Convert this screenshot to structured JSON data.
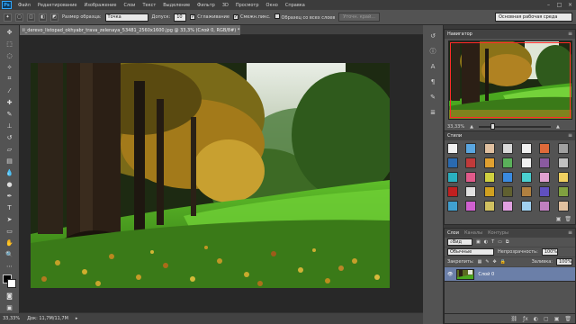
{
  "app": {
    "logo_text": "Ps"
  },
  "menu": [
    "Файл",
    "Редактирование",
    "Изображение",
    "Слои",
    "Текст",
    "Выделение",
    "Фильтр",
    "3D",
    "Просмотр",
    "Окно",
    "Справка"
  ],
  "window_controls": {
    "minimize": "–",
    "maximize": "□",
    "close": "×"
  },
  "options_bar": {
    "sample_size_label": "Размер образца:",
    "sample_size_value": "Точка",
    "tolerance_label": "Допуск:",
    "tolerance_value": "10",
    "anti_alias_label": "Сглаживание",
    "contiguous_label": "Смежн.пикс.",
    "all_layers_label": "Образец со всех слоев",
    "refine_edge_button": "Уточн. край...",
    "workspace_value": "Основная рабочая среда"
  },
  "document": {
    "tab_title": "ii_derevo_listopad_okhyabr_trava_zelenaya_53481_2560x1600.jpg @ 33,3% (Слой 0, RGB/8#) *",
    "tab_close": "×",
    "zoom": "33,33%",
    "doc_info": "Док: 11,7M/11,7M",
    "status_arrow": "▸"
  },
  "navigator": {
    "title": "Навигатор",
    "zoom": "33,33%",
    "zoom_level": 0.18
  },
  "swatches": {
    "title": "Стили",
    "colors": [
      "#f0f0f0",
      "#5aa6e0",
      "#e0c0a0",
      "#d8d8d8",
      "#f0f0f0",
      "#e06a3a",
      "#a0a0a0",
      "#2a6ab0",
      "#c03a3a",
      "#e0a030",
      "#5ab05a",
      "#f0f0f0",
      "#8a5aa0",
      "#c0c0c0",
      "#2ab0c0",
      "#e05a8a",
      "#d0d040",
      "#3a8ae0",
      "#4ad0d0",
      "#e0a0d0",
      "#f0d060",
      "#c02020",
      "#e0e0e0",
      "#d0a020",
      "#606030",
      "#b08040",
      "#6050c0",
      "#80a040",
      "#40a0d0",
      "#d060d0",
      "#d0c060",
      "#e0a0e0",
      "#a0d0f0",
      "#c080c0",
      "#e0c0a0"
    ],
    "trash": "🗑",
    "new": "▣"
  },
  "layers": {
    "tabs": [
      "Слои",
      "Каналы",
      "Контуры"
    ],
    "kind_label": "Вид",
    "blend_mode": "Обычные",
    "opacity_label": "Непрозрачность:",
    "opacity_value": "100%",
    "lock_label": "Закрепить:",
    "fill_label": "Заливка:",
    "fill_value": "100%",
    "items": [
      {
        "name": "Слой 0"
      }
    ],
    "foot_icons": [
      "ƒx",
      "◐",
      "▢",
      "▣",
      "🗑"
    ]
  }
}
